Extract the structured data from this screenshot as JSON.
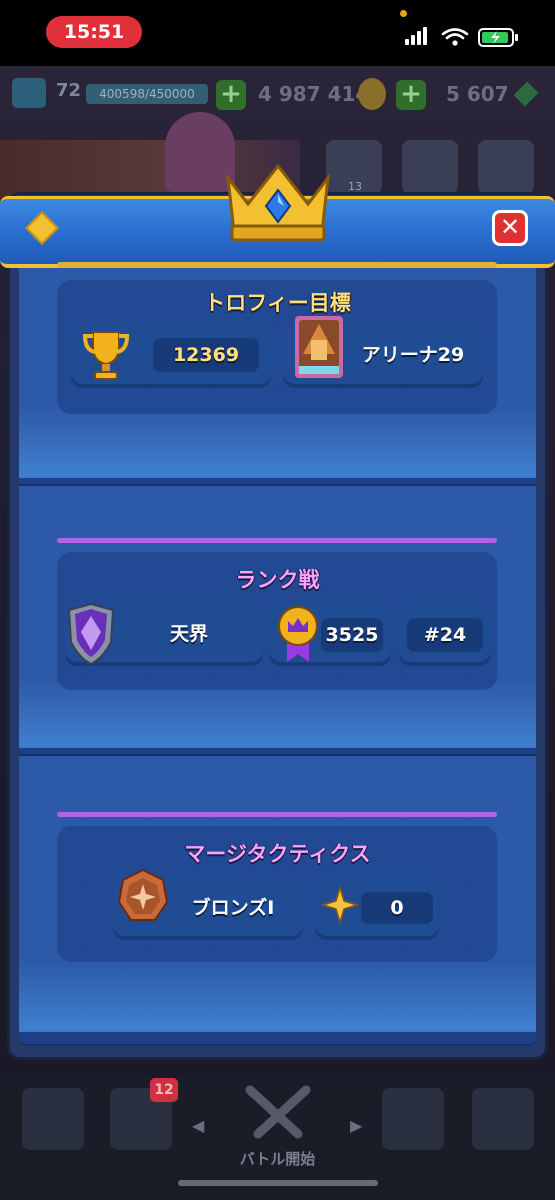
{
  "status_bar": {
    "time": "15:51"
  },
  "background_hud": {
    "level": "72",
    "xp": "400598/450000",
    "gold": "4 987 414",
    "gems": "5 607",
    "friends_count": "13",
    "nav_badge": "12",
    "battle_label": "バトル開始"
  },
  "modal": {
    "close_label": "✕",
    "trophy_section": {
      "title": "トロフィー目標",
      "trophies": "12369",
      "arena": "アリーナ29"
    },
    "ranked_section": {
      "title": "ランク戦",
      "league": "天界",
      "rating": "3525",
      "rank": "#24"
    },
    "tactics_section": {
      "title": "マージタクティクス",
      "league": "ブロンズI",
      "points": "0"
    }
  },
  "colors": {
    "accent_gold": "#ffe07a",
    "accent_purple": "#b062e8",
    "panel_blue": "#2d5aa8",
    "close_red": "#e03030"
  }
}
